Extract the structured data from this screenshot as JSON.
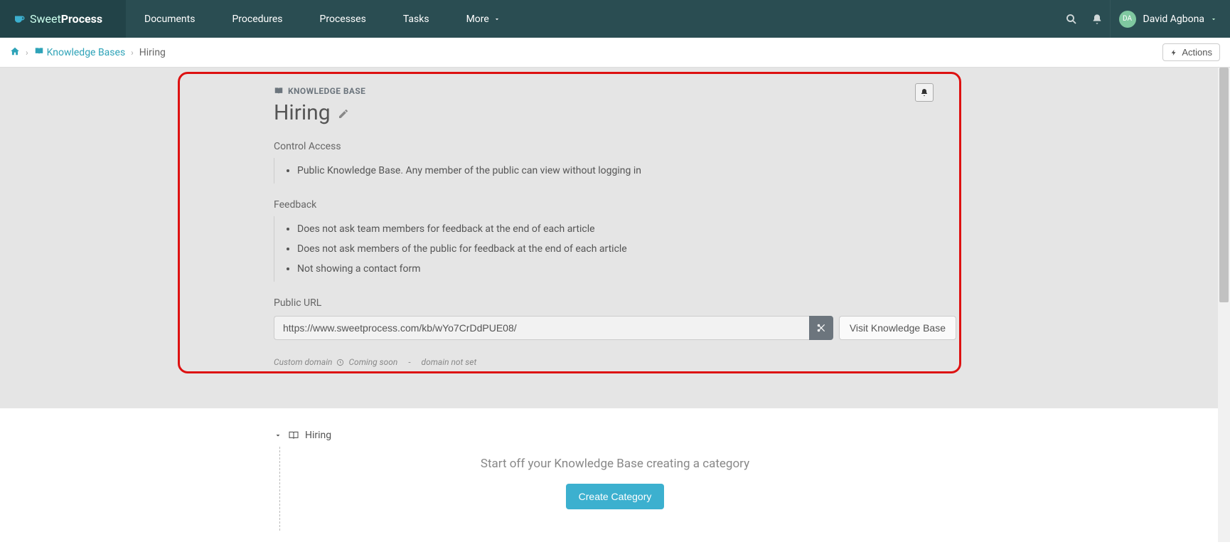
{
  "brand": {
    "sweet": "Sweet",
    "process": "Process"
  },
  "nav": {
    "items": [
      "Documents",
      "Procedures",
      "Processes",
      "Tasks",
      "More"
    ]
  },
  "user": {
    "initials": "DA",
    "name": "David Agbona"
  },
  "breadcrumb": {
    "kb_link": "Knowledge Bases",
    "current": "Hiring",
    "actions_label": "Actions"
  },
  "kb": {
    "badge": "KNOWLEDGE BASE",
    "title": "Hiring",
    "sections": {
      "control_access": {
        "heading": "Control Access",
        "items": [
          "Public Knowledge Base. Any member of the public can view without logging in"
        ]
      },
      "feedback": {
        "heading": "Feedback",
        "items": [
          "Does not ask team members for feedback at the end of each article",
          "Does not ask members of the public for feedback at the end of each article",
          "Not showing a contact form"
        ]
      },
      "public_url": {
        "heading": "Public URL",
        "value": "https://www.sweetprocess.com/kb/wYo7CrDdPUE08/",
        "visit_label": "Visit Knowledge Base"
      }
    },
    "custom_domain": {
      "label": "Custom domain",
      "coming": "Coming soon",
      "sep": "-",
      "not_set": "domain not set"
    }
  },
  "tree": {
    "root": "Hiring",
    "empty_prompt": "Start off your Knowledge Base creating a category",
    "create_label": "Create Category"
  }
}
